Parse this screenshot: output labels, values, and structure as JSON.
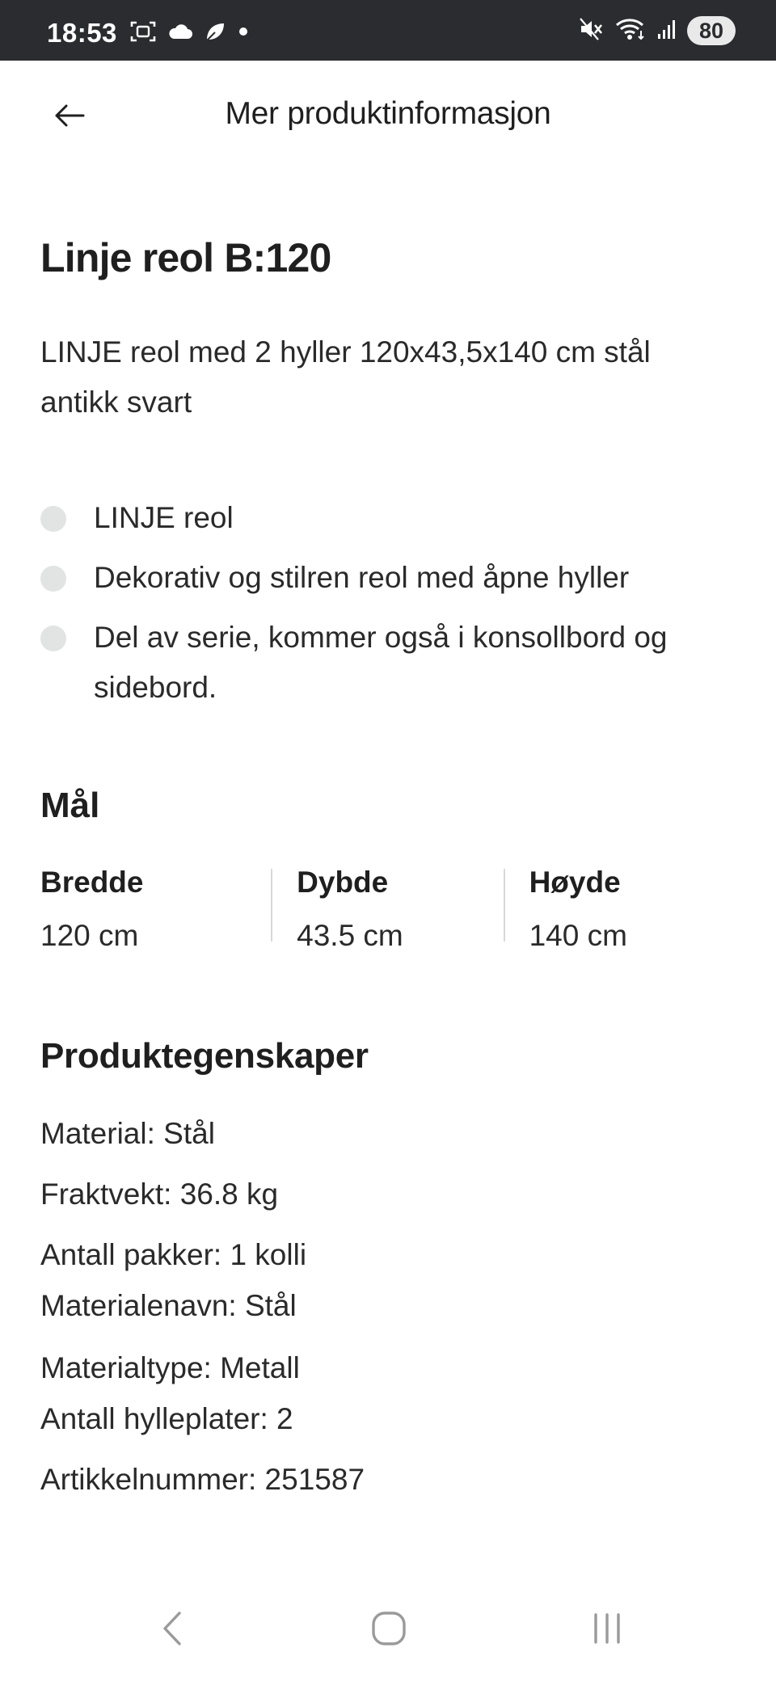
{
  "status_bar": {
    "time": "18:53",
    "battery": "80",
    "left_icons": [
      "screenshot-icon",
      "cloud-icon",
      "leaf-icon",
      "dot-icon"
    ],
    "right_icons": [
      "mute-icon",
      "wifi-icon",
      "signal-icon"
    ]
  },
  "appbar": {
    "title": "Mer produktinformasjon",
    "back_icon": "arrow-left-icon"
  },
  "product": {
    "title": "Linje reol B:120",
    "description": "LINJE reol med 2 hyller 120x43,5x140 cm stål antikk svart",
    "bullets": [
      "LINJE reol",
      "Dekorativ og stilren reol med åpne hyller",
      "Del av serie, kommer også i konsollbord og sidebord."
    ]
  },
  "dimensions": {
    "heading": "Mål",
    "items": [
      {
        "label": "Bredde",
        "value": "120 cm"
      },
      {
        "label": "Dybde",
        "value": "43.5 cm"
      },
      {
        "label": "Høyde",
        "value": "140 cm"
      }
    ]
  },
  "properties": {
    "heading": "Produktegenskaper",
    "items": [
      "Material: Stål",
      "Fraktvekt: 36.8 kg",
      "Antall pakker: 1 kolli",
      "Materialenavn: Stål",
      "Materialtype: Metall",
      "Antall hylleplater: 2",
      "Artikkelnummer: 251587"
    ]
  },
  "navbar": {
    "icons": [
      "back-nav-icon",
      "home-nav-icon",
      "recents-nav-icon"
    ]
  },
  "colors": {
    "status_bar_bg": "#2b2c30",
    "bullet_dot": "#e1e4e3",
    "divider": "#d8d8d8"
  }
}
